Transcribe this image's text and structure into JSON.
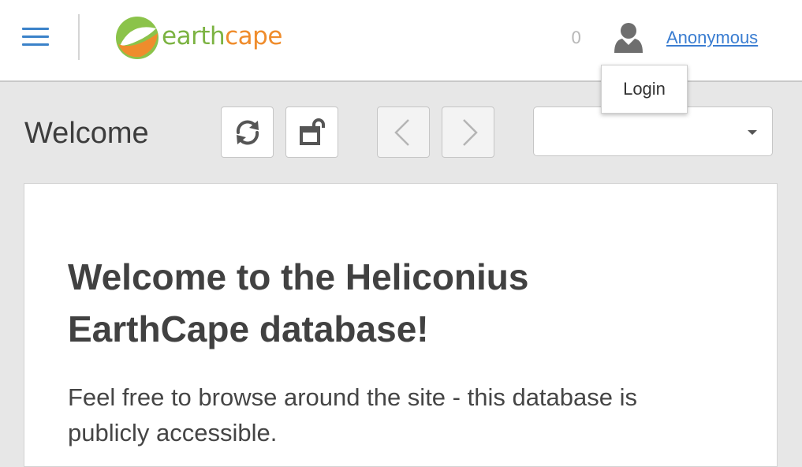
{
  "header": {
    "logo": {
      "part1": "earth",
      "part2": "cape",
      "colors": {
        "green": "#7cb342",
        "orange": "#ef8c2c"
      }
    },
    "counter": "0",
    "user_name": "Anonymous",
    "menu_icon": "hamburger-icon",
    "user_icon": "user-icon"
  },
  "popup": {
    "login_label": "Login"
  },
  "toolbar": {
    "title": "Welcome",
    "buttons": [
      "refresh-icon",
      "open-new-window-icon",
      "chevron-left-icon",
      "chevron-right-icon"
    ],
    "select_value": ""
  },
  "content": {
    "heading": "Welcome to the Heliconius EarthCape database!",
    "paragraph": "Feel free to browse around the site - this database is publicly accessible."
  },
  "colors": {
    "accent": "#3b82c9",
    "link": "#3a7dd1",
    "background": "#e7e7e7"
  }
}
